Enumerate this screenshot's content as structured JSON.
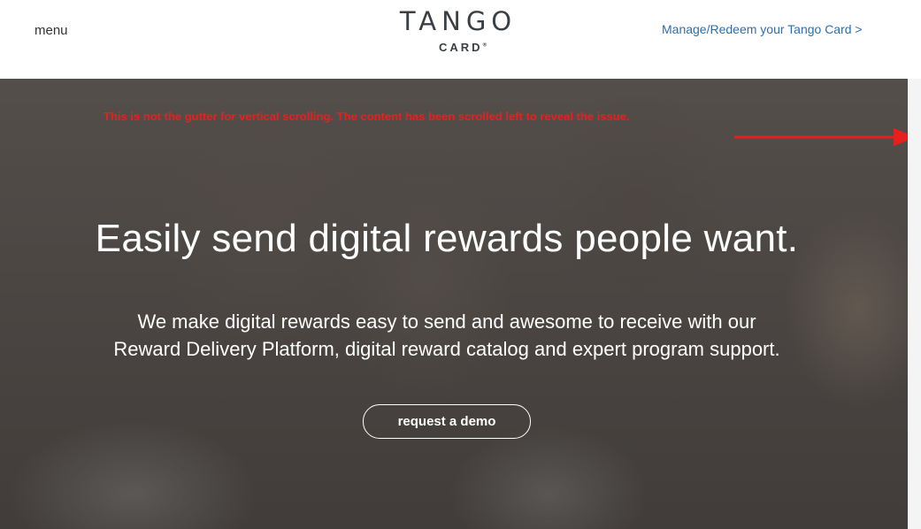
{
  "header": {
    "menu_label": "menu",
    "logo": {
      "main": "TANGO",
      "sub": "CARD",
      "mark": "®"
    },
    "manage_link": "Manage/Redeem your Tango Card >"
  },
  "annotation": {
    "text": "This is not the gutter for vertical scrolling. The content has been scrolled left to reveal the issue.",
    "color": "#e8201d"
  },
  "hero": {
    "title": "Easily send digital rewards people want.",
    "subtitle_line1": "We make digital rewards easy to send and awesome to receive with our",
    "subtitle_line2": "Reward Delivery Platform, digital reward catalog and expert program support.",
    "cta_label": "request a demo"
  },
  "colors": {
    "link": "#2b6fb0",
    "logo": "#3a3f45",
    "annotation": "#e8201d"
  }
}
